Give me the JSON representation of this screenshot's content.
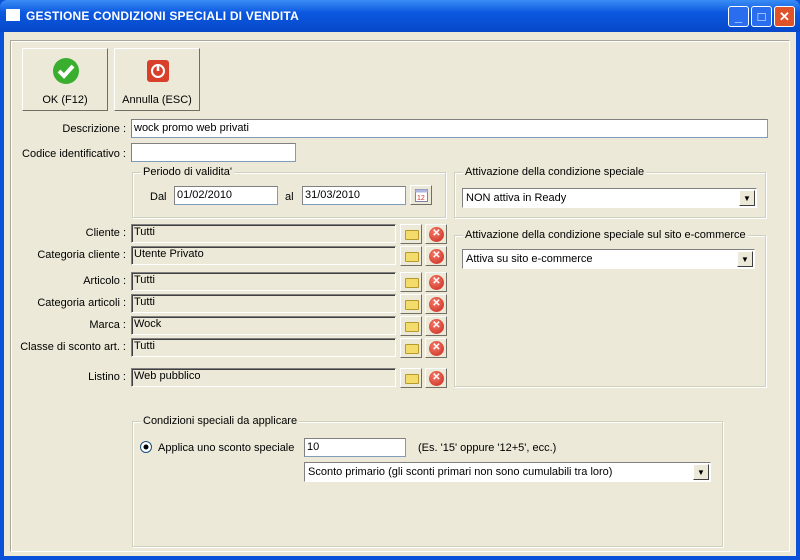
{
  "window": {
    "title": "GESTIONE CONDIZIONI SPECIALI DI VENDITA"
  },
  "toolbar": {
    "ok_label": "OK (F12)",
    "cancel_label": "Annulla (ESC)"
  },
  "form": {
    "descrizione_label": "Descrizione :",
    "descrizione_value": "wock promo web privati",
    "codice_label": "Codice identificativo :",
    "codice_value": "",
    "periodo": {
      "legend": "Periodo di validita'",
      "dal_label": "Dal",
      "dal_value": "01/02/2010",
      "al_label": "al",
      "al_value": "31/03/2010"
    },
    "attivazione": {
      "legend": "Attivazione della condizione speciale",
      "value": "NON attiva in Ready"
    },
    "attivazione_ecommerce": {
      "legend": "Attivazione della condizione speciale sul sito e-commerce",
      "value": "Attiva su sito e-commerce"
    },
    "lookups": [
      {
        "label": "Cliente :",
        "value": "Tutti"
      },
      {
        "label": "Categoria cliente :",
        "value": "Utente Privato"
      },
      {
        "label": "Articolo :",
        "value": "Tutti"
      },
      {
        "label": "Categoria articoli :",
        "value": "Tutti"
      },
      {
        "label": "Marca :",
        "value": "Wock"
      },
      {
        "label": "Classe di sconto art. :",
        "value": "Tutti"
      },
      {
        "label": "Listino :",
        "value": "Web pubblico"
      }
    ],
    "condizioni": {
      "legend": "Condizioni speciali da applicare",
      "radio_label": "Applica uno sconto speciale",
      "radio_checked": true,
      "sconto_value": "10",
      "hint": "(Es. '15' oppure '12+5', ecc.)",
      "tipo_value": "Sconto primario (gli sconti primari non sono cumulabili tra loro)"
    }
  }
}
